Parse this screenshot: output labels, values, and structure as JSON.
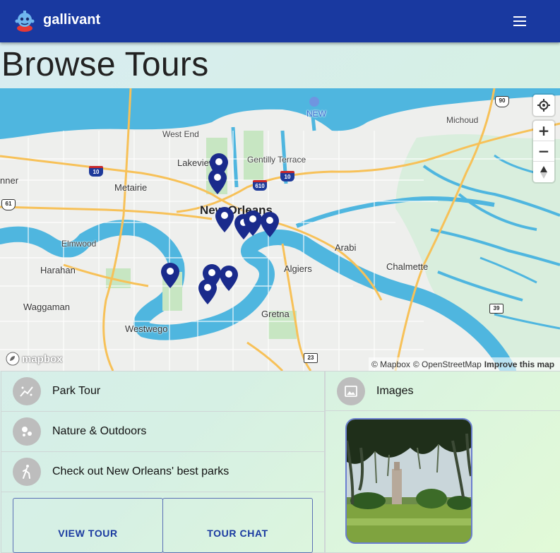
{
  "app": {
    "brand": "gallivant",
    "menu_icon": "hamburger-menu-icon"
  },
  "page": {
    "title": "Browse Tours"
  },
  "map": {
    "labels": {
      "west_end": "West End",
      "lakeview": "Lakeview",
      "gentilly": "Gentilly Terrace",
      "metairie": "Metairie",
      "new_orleans": "New Orleans",
      "elmwood": "Elmwood",
      "harahan": "Harahan",
      "waggaman": "Waggaman",
      "westwego": "Westwego",
      "gretna": "Gretna",
      "algiers": "Algiers",
      "arabi": "Arabi",
      "chalmette": "Chalmette",
      "michoud": "Michoud",
      "kenner": "nner",
      "airport": "NEW"
    },
    "shields": {
      "i10_west": "10",
      "i610": "610",
      "i10_east": "10",
      "us61": "61",
      "us90": "90",
      "la39": "39",
      "la23": "23"
    },
    "zoom_in": "+",
    "zoom_out": "−",
    "logo_text": "mapbox",
    "attribution": {
      "mapbox": "© Mapbox",
      "osm": "© OpenStreetMap",
      "improve": "Improve this map"
    },
    "marker_color": "#1a2b8c",
    "water_color": "#4fb6df"
  },
  "tour": {
    "name": "Park Tour",
    "category": "Nature & Outdoors",
    "description": "Check out New Orleans' best parks",
    "view_button": "VIEW TOUR",
    "chat_button": "TOUR CHAT"
  },
  "images": {
    "heading": "Images"
  }
}
